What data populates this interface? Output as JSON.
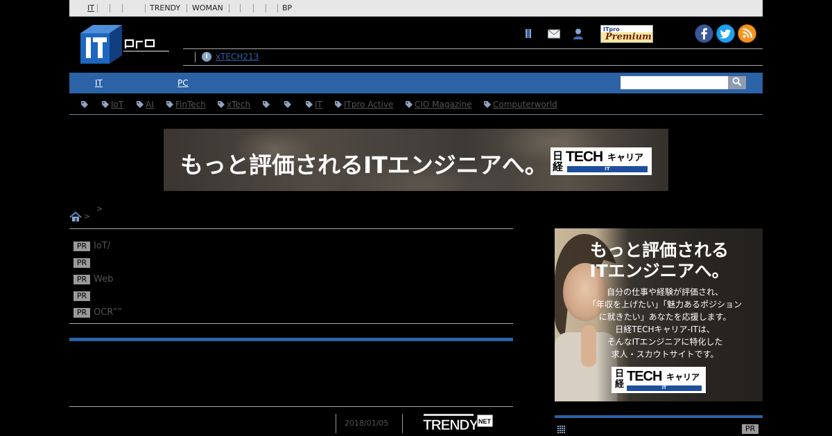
{
  "topbar": {
    "links": [
      "IT",
      "TRENDY",
      "WOMAN",
      "BP"
    ]
  },
  "header": {
    "logo_text": "ITpro",
    "premium_small": "ITpro",
    "premium_big": "Premium",
    "icons": [
      "bookmark-icon",
      "mail-icon",
      "user-icon"
    ],
    "social": [
      {
        "name": "facebook-icon",
        "color": "#3b5998"
      },
      {
        "name": "twitter-icon",
        "color": "#1da1f2"
      },
      {
        "name": "rss-icon",
        "color": "#f6931f"
      }
    ],
    "news_icon": "i",
    "news_text": "xTECH213"
  },
  "nav": {
    "items": [
      "IT",
      "PC"
    ],
    "search_placeholder": ""
  },
  "tags": [
    "",
    "IoT",
    "AI",
    "FinTech",
    "xTech",
    "",
    "",
    "IT",
    "ITpro Active",
    "CIO Magazine",
    "Computerworld"
  ],
  "banner": {
    "headline": "もっと評価されるITエンジニアへ。",
    "brand_jp": "日経",
    "brand_tech": "TECH",
    "brand_kana": "キャリア",
    "brand_sub": "IT"
  },
  "breadcrumb": {
    "separators": [
      ">",
      ">"
    ]
  },
  "pr_list": [
    {
      "badge": "PR",
      "text": "IoT/"
    },
    {
      "badge": "PR",
      "text": ""
    },
    {
      "badge": "PR",
      "text": "Web"
    },
    {
      "badge": "PR",
      "text": ""
    },
    {
      "badge": "PR",
      "text": "OCR””"
    }
  ],
  "article": {
    "date": "2018/01/05",
    "source_logo": "TRENDY",
    "source_logo_sub": "NET"
  },
  "side_ad": {
    "headline_1": "もっと評価される",
    "headline_2": "ITエンジニアへ。",
    "lines": [
      "自分の仕事や経験が評価され、",
      "「年収を上げたい」「魅力あるポジション",
      "に就きたい」あなたを応援します。",
      "日経TECHキャリア-ITは、",
      "そんなITエンジニアに特化した",
      "求人・スカウトサイトです。"
    ],
    "brand_jp_1": "日",
    "brand_jp_2": "経",
    "brand_tech": "TECH",
    "brand_kana": "キャリア",
    "brand_sub": "IT"
  },
  "side_bottom": {
    "badge": "PR"
  },
  "colors": {
    "nav_blue": "#2c62a6",
    "link_blue": "#2f63a8",
    "background": "#000000"
  }
}
